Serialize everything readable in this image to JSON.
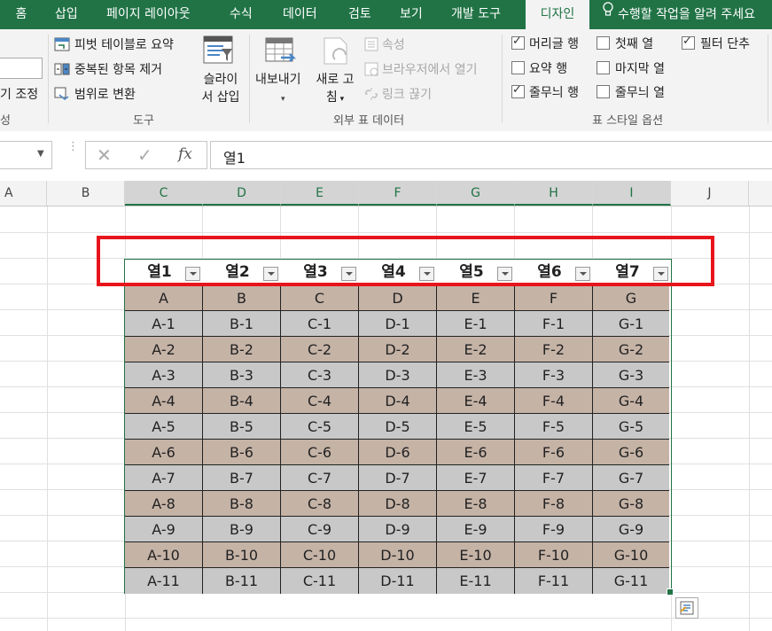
{
  "ribbon_tabs": [
    "홈",
    "삽입",
    "페이지 레이아웃",
    "수식",
    "데이터",
    "검토",
    "보기",
    "개발 도구",
    "디자인"
  ],
  "tell_me": "수행할 작업을 알려 주세요",
  "ribbon": {
    "left_partial": {
      "resize_label": "기 조정",
      "group_partial": "성"
    },
    "tools": {
      "pivot": "피벗 테이블로 요약",
      "dedupe": "중복된 항목 제거",
      "to_range": "범위로 변환",
      "slicer_line1": "슬라이",
      "slicer_line2": "서 삽입",
      "group_label": "도구"
    },
    "external": {
      "export_label": "내보내기",
      "refresh_line1": "새로 고",
      "refresh_line2": "침",
      "properties": "속성",
      "open_browser": "브라우저에서 열기",
      "unlink": "링크 끊기",
      "group_label": "외부 표 데이터"
    },
    "style_options": {
      "header_row": "머리글 행",
      "total_row": "요약 행",
      "banded_rows": "줄무늬 행",
      "first_column": "첫째 열",
      "last_column": "마지막 열",
      "banded_columns": "줄무늬 열",
      "filter_button": "필터 단추",
      "header_row_checked": true,
      "total_row_checked": false,
      "banded_rows_checked": true,
      "first_column_checked": false,
      "last_column_checked": false,
      "banded_columns_checked": false,
      "filter_button_checked": true,
      "group_label": "표 스타일 옵션"
    }
  },
  "formula_bar": {
    "fx": "fx",
    "value": "열1"
  },
  "columns": [
    "A",
    "B",
    "C",
    "D",
    "E",
    "F",
    "G",
    "H",
    "I",
    "J"
  ],
  "table": {
    "headers": [
      "열1",
      "열2",
      "열3",
      "열4",
      "열5",
      "열6",
      "열7"
    ],
    "rows": [
      [
        "A",
        "B",
        "C",
        "D",
        "E",
        "F",
        "G"
      ],
      [
        "A-1",
        "B-1",
        "C-1",
        "D-1",
        "E-1",
        "F-1",
        "G-1"
      ],
      [
        "A-2",
        "B-2",
        "C-2",
        "D-2",
        "E-2",
        "F-2",
        "G-2"
      ],
      [
        "A-3",
        "B-3",
        "C-3",
        "D-3",
        "E-3",
        "F-3",
        "G-3"
      ],
      [
        "A-4",
        "B-4",
        "C-4",
        "D-4",
        "E-4",
        "F-4",
        "G-4"
      ],
      [
        "A-5",
        "B-5",
        "C-5",
        "D-5",
        "E-5",
        "F-5",
        "G-5"
      ],
      [
        "A-6",
        "B-6",
        "C-6",
        "D-6",
        "E-6",
        "F-6",
        "G-6"
      ],
      [
        "A-7",
        "B-7",
        "C-7",
        "D-7",
        "E-7",
        "F-7",
        "G-7"
      ],
      [
        "A-8",
        "B-8",
        "C-8",
        "D-8",
        "E-8",
        "F-8",
        "G-8"
      ],
      [
        "A-9",
        "B-9",
        "C-9",
        "D-9",
        "E-9",
        "F-9",
        "G-9"
      ],
      [
        "A-10",
        "B-10",
        "C-10",
        "D-10",
        "E-10",
        "F-10",
        "G-10"
      ],
      [
        "A-11",
        "B-11",
        "C-11",
        "D-11",
        "E-11",
        "F-11",
        "G-11"
      ]
    ]
  },
  "colors": {
    "brand": "#217346",
    "band_a": "#c5b3a6",
    "band_b": "#c8c8c8",
    "highlight": "#e8141c"
  }
}
